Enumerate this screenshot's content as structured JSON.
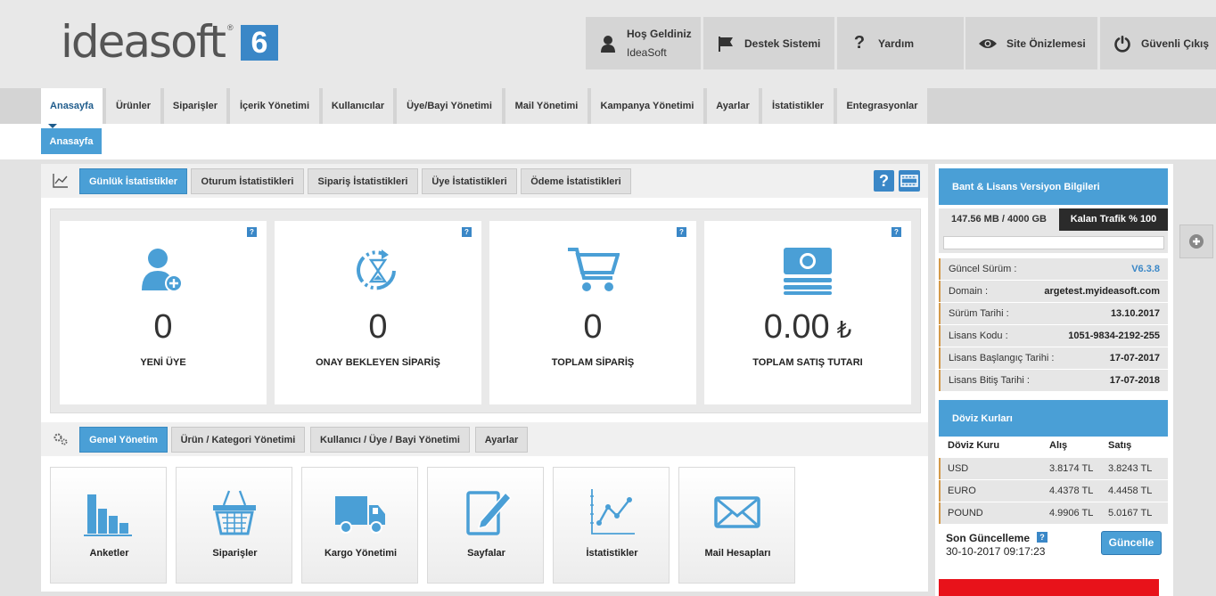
{
  "header": {
    "logo_text": "ideasoft",
    "logo_reg": "®",
    "logo_badge": "6",
    "welcome_title": "Hoş Geldiniz",
    "welcome_user": "IdeaSoft",
    "support": "Destek Sistemi",
    "help": "Yardım",
    "preview": "Site Önizlemesi",
    "logout": "Güvenli Çıkış"
  },
  "nav": [
    "Anasayfa",
    "Ürünler",
    "Siparişler",
    "İçerik Yönetimi",
    "Kullanıcılar",
    "Üye/Bayi Yönetimi",
    "Mail Yönetimi",
    "Kampanya Yönetimi",
    "Ayarlar",
    "İstatistikler",
    "Entegrasyonlar"
  ],
  "subnav": {
    "active": "Anasayfa"
  },
  "stats_tabs": [
    "Günlük İstatistikler",
    "Oturum İstatistikleri",
    "Sipariş İstatistikleri",
    "Üye İstatistikleri",
    "Ödeme İstatistikleri"
  ],
  "help_glyph": "?",
  "stats": [
    {
      "value": "0",
      "label": "YENİ ÜYE"
    },
    {
      "value": "0",
      "label": "ONAY BEKLEYEN SİPARİŞ"
    },
    {
      "value": "0",
      "label": "TOPLAM SİPARİŞ"
    },
    {
      "value": "0.00",
      "currency": "₺",
      "label": "TOPLAM SATIŞ TUTARI"
    }
  ],
  "mgmt_tabs": [
    "Genel Yönetim",
    "Ürün / Kategori Yönetimi",
    "Kullanıcı / Üye / Bayi Yönetimi",
    "Ayarlar"
  ],
  "mgmt_cards": [
    "Anketler",
    "Siparişler",
    "Kargo Yönetimi",
    "Sayfalar",
    "İstatistikler",
    "Mail Hesapları"
  ],
  "license": {
    "title": "Bant & Lisans Versiyon Bilgileri",
    "usage": "147.56 MB / 4000 GB",
    "traffic": "Kalan Trafik % 100",
    "rows": [
      {
        "k": "Güncel Sürüm :",
        "v": "V6.3.8"
      },
      {
        "k": "Domain :",
        "v": "argetest.myideasoft.com"
      },
      {
        "k": "Sürüm Tarihi :",
        "v": "13.10.2017"
      },
      {
        "k": "Lisans Kodu :",
        "v": "1051-9834-2192-255"
      },
      {
        "k": "Lisans Başlangıç Tarihi :",
        "v": "17-07-2017"
      },
      {
        "k": "Lisans Bitiş Tarihi :",
        "v": "17-07-2018"
      }
    ]
  },
  "fx": {
    "title": "Döviz Kurları",
    "headers": [
      "Döviz Kuru",
      "Alış",
      "Satış"
    ],
    "rows": [
      {
        "c": "USD",
        "buy": "3.8174 TL",
        "sell": "3.8243 TL"
      },
      {
        "c": "EURO",
        "buy": "4.4378 TL",
        "sell": "4.4458 TL"
      },
      {
        "c": "POUND",
        "buy": "4.9906 TL",
        "sell": "5.0167 TL"
      }
    ],
    "updated_label": "Son Güncelleme",
    "updated_at": "30-10-2017 09:17:23",
    "update_button": "Güncelle"
  },
  "colors": {
    "accent": "#4a9fd6",
    "brand": "#3a87c7",
    "danger": "#e8121a",
    "version": "#3a87c7"
  }
}
